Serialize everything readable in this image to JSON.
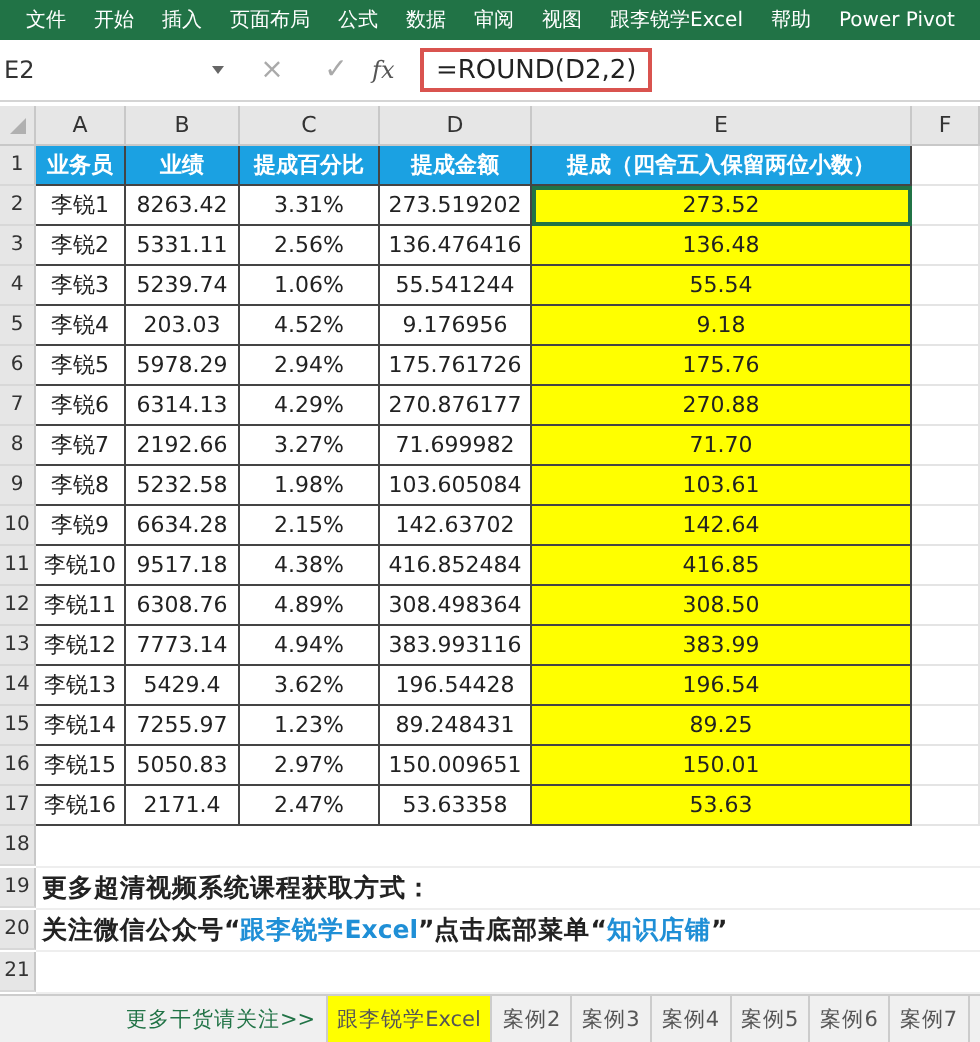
{
  "ribbon": {
    "tabs": [
      "文件",
      "开始",
      "插入",
      "页面布局",
      "公式",
      "数据",
      "审阅",
      "视图",
      "跟李锐学Excel",
      "帮助",
      "Power Pivot"
    ]
  },
  "formula_bar": {
    "cell_ref": "E2",
    "cancel": "×",
    "enter": "✓",
    "fx": "fx",
    "formula": "=ROUND(D2,2)"
  },
  "columns": [
    "A",
    "B",
    "C",
    "D",
    "E",
    "F"
  ],
  "table": {
    "header": [
      "业务员",
      "业绩",
      "提成百分比",
      "提成金额",
      "提成（四舍五入保留两位小数）"
    ],
    "rows": [
      [
        "李锐1",
        "8263.42",
        "3.31%",
        "273.519202",
        "273.52"
      ],
      [
        "李锐2",
        "5331.11",
        "2.56%",
        "136.476416",
        "136.48"
      ],
      [
        "李锐3",
        "5239.74",
        "1.06%",
        "55.541244",
        "55.54"
      ],
      [
        "李锐4",
        "203.03",
        "4.52%",
        "9.176956",
        "9.18"
      ],
      [
        "李锐5",
        "5978.29",
        "2.94%",
        "175.761726",
        "175.76"
      ],
      [
        "李锐6",
        "6314.13",
        "4.29%",
        "270.876177",
        "270.88"
      ],
      [
        "李锐7",
        "2192.66",
        "3.27%",
        "71.699982",
        "71.70"
      ],
      [
        "李锐8",
        "5232.58",
        "1.98%",
        "103.605084",
        "103.61"
      ],
      [
        "李锐9",
        "6634.28",
        "2.15%",
        "142.63702",
        "142.64"
      ],
      [
        "李锐10",
        "9517.18",
        "4.38%",
        "416.852484",
        "416.85"
      ],
      [
        "李锐11",
        "6308.76",
        "4.89%",
        "308.498364",
        "308.50"
      ],
      [
        "李锐12",
        "7773.14",
        "4.94%",
        "383.993116",
        "383.99"
      ],
      [
        "李锐13",
        "5429.4",
        "3.62%",
        "196.54428",
        "196.54"
      ],
      [
        "李锐14",
        "7255.97",
        "1.23%",
        "89.248431",
        "89.25"
      ],
      [
        "李锐15",
        "5050.83",
        "2.97%",
        "150.009651",
        "150.01"
      ],
      [
        "李锐16",
        "2171.4",
        "2.47%",
        "53.63358",
        "53.63"
      ]
    ]
  },
  "notes": [
    {
      "segments": [
        {
          "text": "更多超清视频系统课程获取方式：",
          "highlight": false
        }
      ]
    },
    {
      "segments": [
        {
          "text": "关注微信公众号“",
          "highlight": false
        },
        {
          "text": "跟李锐学Excel",
          "highlight": true
        },
        {
          "text": "”点击底部菜单“",
          "highlight": false
        },
        {
          "text": "知识店铺",
          "highlight": true
        },
        {
          "text": "”",
          "highlight": false
        }
      ]
    }
  ],
  "row_numbers": [
    "1",
    "2",
    "3",
    "4",
    "5",
    "6",
    "7",
    "8",
    "9",
    "10",
    "11",
    "12",
    "13",
    "14",
    "15",
    "16",
    "17",
    "18",
    "19",
    "20",
    "21"
  ],
  "sheet_tabs": [
    {
      "label": "更多干货请关注>>",
      "kind": "link",
      "selected": false
    },
    {
      "label": "跟李锐学Excel",
      "kind": "sheet",
      "selected": true
    },
    {
      "label": "案例2",
      "kind": "sheet",
      "selected": false
    },
    {
      "label": "案例3",
      "kind": "sheet",
      "selected": false
    },
    {
      "label": "案例4",
      "kind": "sheet",
      "selected": false
    },
    {
      "label": "案例5",
      "kind": "sheet",
      "selected": false
    },
    {
      "label": "案例6",
      "kind": "sheet",
      "selected": false
    },
    {
      "label": "案例7",
      "kind": "sheet",
      "selected": false
    }
  ]
}
